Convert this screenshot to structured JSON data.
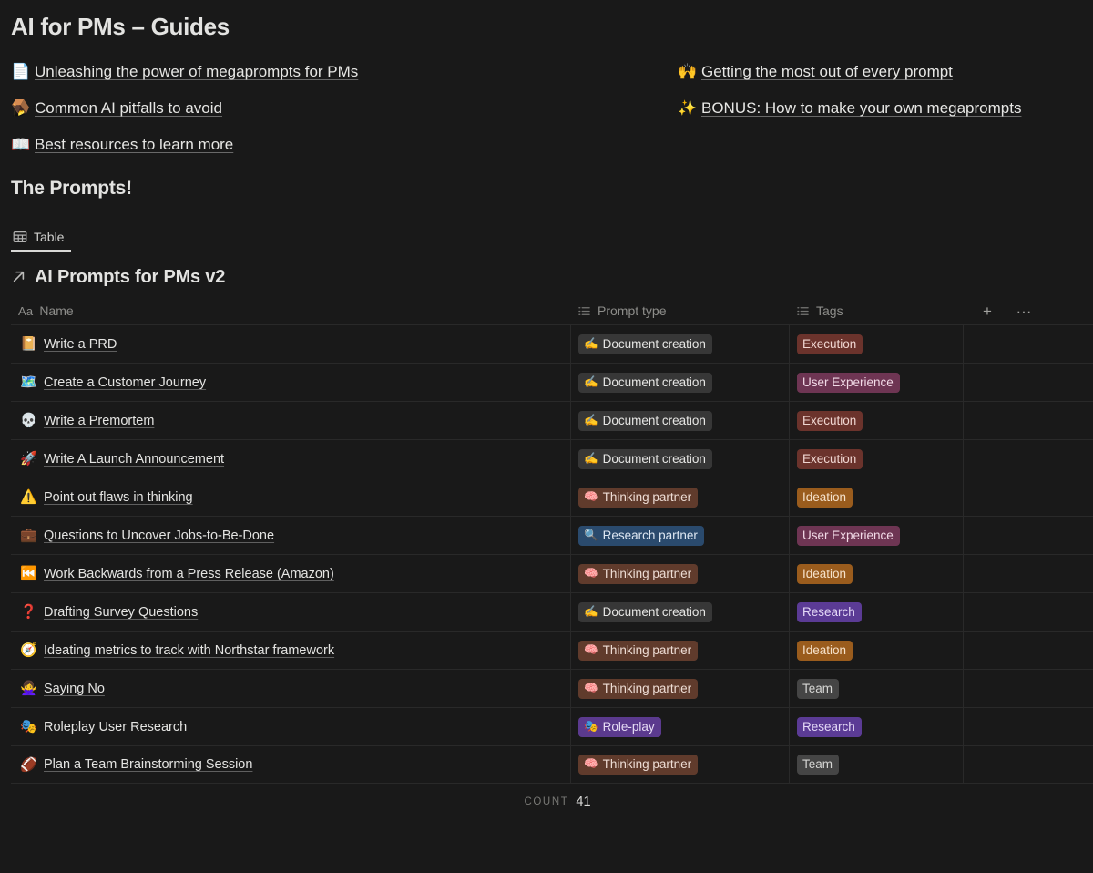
{
  "page": {
    "title": "AI for PMs – Guides"
  },
  "guides": {
    "left": [
      {
        "emoji": "📄",
        "icon_name": "page-icon",
        "label": "Unleashing the power of megaprompts for PMs"
      },
      {
        "emoji": "🪤",
        "icon_name": "mousetrap-icon",
        "label": "Common AI pitfalls to avoid"
      },
      {
        "emoji": "📖",
        "icon_name": "open-book-icon",
        "label": "Best resources to learn more"
      }
    ],
    "right": [
      {
        "emoji": "🙌",
        "icon_name": "raising-hands-icon",
        "label": "Getting the most out of every prompt"
      },
      {
        "emoji": "✨",
        "icon_name": "sparkles-icon",
        "label": "BONUS: How to make your own megaprompts"
      }
    ]
  },
  "section": {
    "title": "The Prompts!"
  },
  "view": {
    "tab_label": "Table",
    "tab_icon": "table-icon"
  },
  "database": {
    "arrow_icon": "arrow-up-right-icon",
    "title": "AI Prompts for PMs v2",
    "columns": [
      {
        "key": "name",
        "label": "Name",
        "icon": "title-aa-icon"
      },
      {
        "key": "type",
        "label": "Prompt type",
        "icon": "multi-select-icon"
      },
      {
        "key": "tags",
        "label": "Tags",
        "icon": "multi-select-icon"
      }
    ],
    "actions": [
      {
        "name": "add-column-button",
        "glyph": "+"
      },
      {
        "name": "more-options-button",
        "glyph": "···"
      }
    ],
    "rows": [
      {
        "emoji": "📔",
        "name": "Write a PRD",
        "type": {
          "label": "Document creation",
          "emoji": "✍️",
          "color": "gray"
        },
        "tag": {
          "label": "Execution",
          "color": "red"
        }
      },
      {
        "emoji": "🗺️",
        "name": "Create a Customer Journey",
        "type": {
          "label": "Document creation",
          "emoji": "✍️",
          "color": "gray"
        },
        "tag": {
          "label": "User Experience",
          "color": "pink"
        }
      },
      {
        "emoji": "💀",
        "name": "Write a Premortem",
        "type": {
          "label": "Document creation",
          "emoji": "✍️",
          "color": "gray"
        },
        "tag": {
          "label": "Execution",
          "color": "red"
        }
      },
      {
        "emoji": "🚀",
        "name": "Write A Launch Announcement",
        "type": {
          "label": "Document creation",
          "emoji": "✍️",
          "color": "gray"
        },
        "tag": {
          "label": "Execution",
          "color": "red"
        }
      },
      {
        "emoji": "⚠️",
        "name": "Point out flaws in thinking",
        "type": {
          "label": "Thinking partner",
          "emoji": "🧠",
          "color": "brown"
        },
        "tag": {
          "label": "Ideation",
          "color": "orange"
        }
      },
      {
        "emoji": "💼",
        "name": "Questions to Uncover Jobs-to-Be-Done",
        "type": {
          "label": "Research partner",
          "emoji": "🔍",
          "color": "blue"
        },
        "tag": {
          "label": "User Experience",
          "color": "pink"
        }
      },
      {
        "emoji": "⏮️",
        "name": "Work Backwards from a Press Release (Amazon)",
        "type": {
          "label": "Thinking partner",
          "emoji": "🧠",
          "color": "brown"
        },
        "tag": {
          "label": "Ideation",
          "color": "orange"
        }
      },
      {
        "emoji": "❓",
        "name": "Drafting Survey Questions",
        "type": {
          "label": "Document creation",
          "emoji": "✍️",
          "color": "gray"
        },
        "tag": {
          "label": "Research",
          "color": "violet"
        }
      },
      {
        "emoji": "🧭",
        "name": "Ideating metrics to track with Northstar framework",
        "type": {
          "label": "Thinking partner",
          "emoji": "🧠",
          "color": "brown"
        },
        "tag": {
          "label": "Ideation",
          "color": "orange"
        }
      },
      {
        "emoji": "🙅‍♀️",
        "name": "Saying No",
        "type": {
          "label": "Thinking partner",
          "emoji": "🧠",
          "color": "brown"
        },
        "tag": {
          "label": "Team",
          "color": "darkgray"
        }
      },
      {
        "emoji": "🎭",
        "name": "Roleplay User Research",
        "type": {
          "label": "Role-play",
          "emoji": "🎭",
          "color": "purple"
        },
        "tag": {
          "label": "Research",
          "color": "violet"
        }
      },
      {
        "emoji": "🏈",
        "name": "Plan a Team Brainstorming Session",
        "type": {
          "label": "Thinking partner",
          "emoji": "🧠",
          "color": "brown"
        },
        "tag": {
          "label": "Team",
          "color": "darkgray"
        }
      }
    ],
    "footer": {
      "count_label": "COUNT",
      "count_value": "41"
    }
  },
  "colors": {
    "background": "#191919",
    "text": "#e3e3e1",
    "muted": "#8d8d8a",
    "divider": "rgba(255,255,255,0.072)"
  }
}
